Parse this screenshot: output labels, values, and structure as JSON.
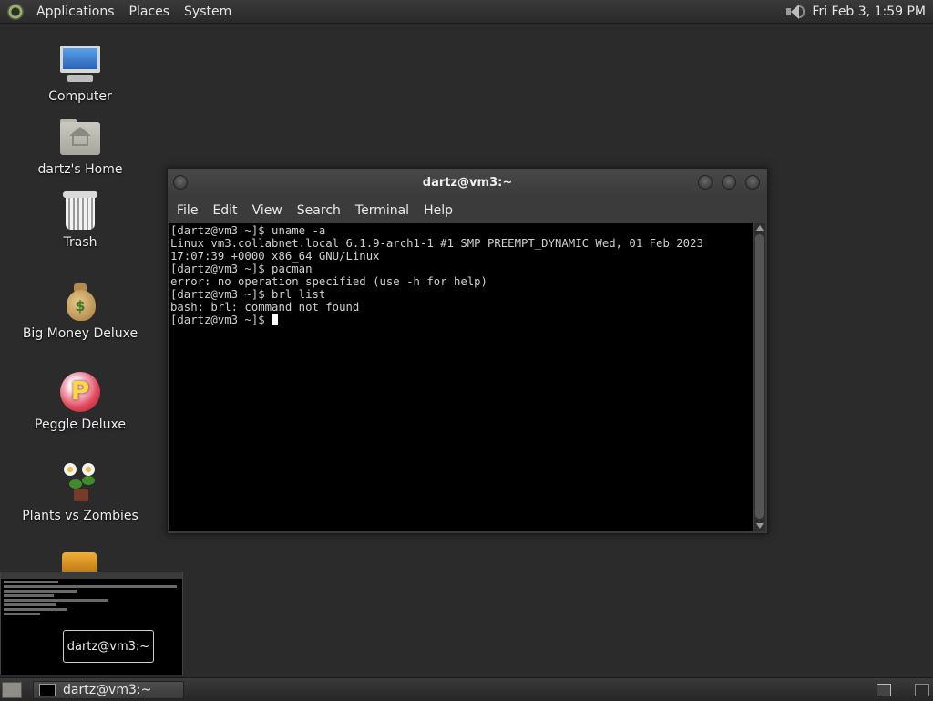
{
  "top_panel": {
    "menus": [
      "Applications",
      "Places",
      "System"
    ],
    "clock": "Fri Feb  3,  1:59 PM"
  },
  "desktop_icons": [
    {
      "label": "Computer",
      "icon": "computer-icon"
    },
    {
      "label": "dartz's Home",
      "icon": "home-folder-icon"
    },
    {
      "label": "Trash",
      "icon": "trash-icon"
    },
    {
      "label": "Big Money Deluxe",
      "icon": "money-bag-icon"
    },
    {
      "label": "Peggle Deluxe",
      "icon": "peggle-icon"
    },
    {
      "label": "Plants vs Zombies",
      "icon": "plants-vs-zombies-icon"
    }
  ],
  "terminal": {
    "title": "dartz@vm3:~",
    "menus": [
      "File",
      "Edit",
      "View",
      "Search",
      "Terminal",
      "Help"
    ],
    "lines": [
      "[dartz@vm3 ~]$ uname -a",
      "Linux vm3.collabnet.local 6.1.9-arch1-1 #1 SMP PREEMPT_DYNAMIC Wed, 01 Feb 2023",
      "17:07:39 +0000 x86_64 GNU/Linux",
      "[dartz@vm3 ~]$ pacman",
      "error: no operation specified (use -h for help)",
      "[dartz@vm3 ~]$ brl list",
      "bash: brl: command not found"
    ],
    "prompt": "[dartz@vm3 ~]$ "
  },
  "preview": {
    "tooltip": "dartz@vm3:~"
  },
  "taskbar": {
    "task_label": "dartz@vm3:~"
  }
}
